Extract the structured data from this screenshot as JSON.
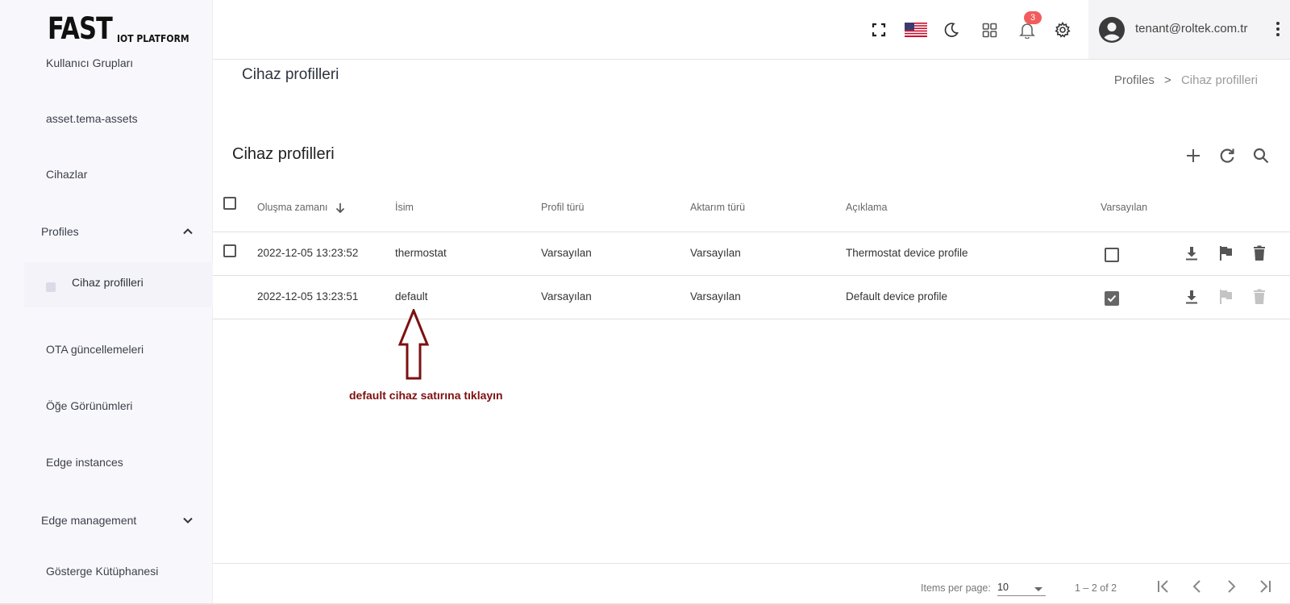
{
  "logo": {
    "main": "FAST",
    "sub": "IOT PLATFORM"
  },
  "sidebar": {
    "items": [
      {
        "label": "Kullanıcı Grupları"
      },
      {
        "label": "asset.tema-assets"
      },
      {
        "label": "Cihazlar"
      },
      {
        "label": "Profiles"
      },
      {
        "label": "Cihaz profilleri"
      },
      {
        "label": "OTA güncellemeleri"
      },
      {
        "label": "Öğe Görünümleri"
      },
      {
        "label": "Edge instances"
      },
      {
        "label": "Edge management"
      },
      {
        "label": "Gösterge Kütüphanesi"
      }
    ]
  },
  "topbar": {
    "notification_count": "3",
    "user_email": "tenant@roltek.com.tr",
    "icons": [
      "fullscreen-icon",
      "us-flag-icon",
      "moon-icon",
      "apps-grid-icon",
      "bell-icon",
      "gear-icon",
      "account-icon",
      "more-vert-icon"
    ]
  },
  "page": {
    "title": "Cihaz profilleri",
    "breadcrumb": {
      "parent": "Profiles",
      "separator": ">",
      "current": "Cihaz profilleri"
    }
  },
  "card": {
    "title": "Cihaz profilleri",
    "columns": {
      "created": "Oluşma zamanı",
      "name": "İsim",
      "profile_type": "Profil türü",
      "transport_type": "Aktarım türü",
      "description": "Açıklama",
      "default": "Varsayılan"
    },
    "rows": [
      {
        "created": "2022-12-05 13:23:52",
        "name": "thermostat",
        "profile_type": "Varsayılan",
        "transport_type": "Varsayılan",
        "description": "Thermostat device profile",
        "is_default": false
      },
      {
        "created": "2022-12-05 13:23:51",
        "name": "default",
        "profile_type": "Varsayılan",
        "transport_type": "Varsayılan",
        "description": "Default device profile",
        "is_default": true
      }
    ]
  },
  "annotation": {
    "hint": "default cihaz satırına tıklayın",
    "color": "#7d1010"
  },
  "footer": {
    "items_per_page_label": "Items per page:",
    "items_per_page_value": "10",
    "range": "1 – 2 of 2"
  }
}
